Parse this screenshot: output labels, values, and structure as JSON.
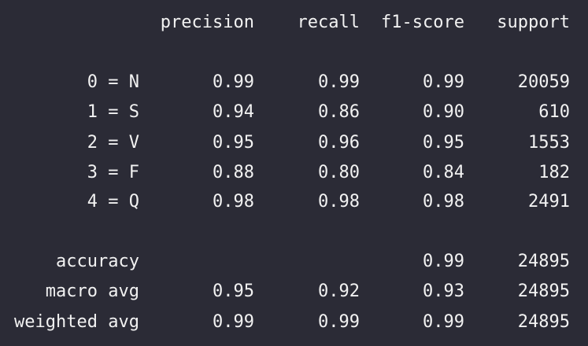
{
  "headers": {
    "precision": "precision",
    "recall": "recall",
    "f1": "f1-score",
    "support": "support"
  },
  "classes": [
    {
      "label": "0 = N",
      "precision": "0.99",
      "recall": "0.99",
      "f1": "0.99",
      "support": "20059"
    },
    {
      "label": "1 = S",
      "precision": "0.94",
      "recall": "0.86",
      "f1": "0.90",
      "support": "610"
    },
    {
      "label": "2 = V",
      "precision": "0.95",
      "recall": "0.96",
      "f1": "0.95",
      "support": "1553"
    },
    {
      "label": "3 = F",
      "precision": "0.88",
      "recall": "0.80",
      "f1": "0.84",
      "support": "182"
    },
    {
      "label": "4 = Q",
      "precision": "0.98",
      "recall": "0.98",
      "f1": "0.98",
      "support": "2491"
    }
  ],
  "summary": [
    {
      "label": "accuracy",
      "precision": "",
      "recall": "",
      "f1": "0.99",
      "support": "24895"
    },
    {
      "label": "macro avg",
      "precision": "0.95",
      "recall": "0.92",
      "f1": "0.93",
      "support": "24895"
    },
    {
      "label": "weighted avg",
      "precision": "0.99",
      "recall": "0.99",
      "f1": "0.99",
      "support": "24895"
    }
  ],
  "colors": {
    "background": "#2b2b36",
    "text": "#f2f2f2"
  }
}
